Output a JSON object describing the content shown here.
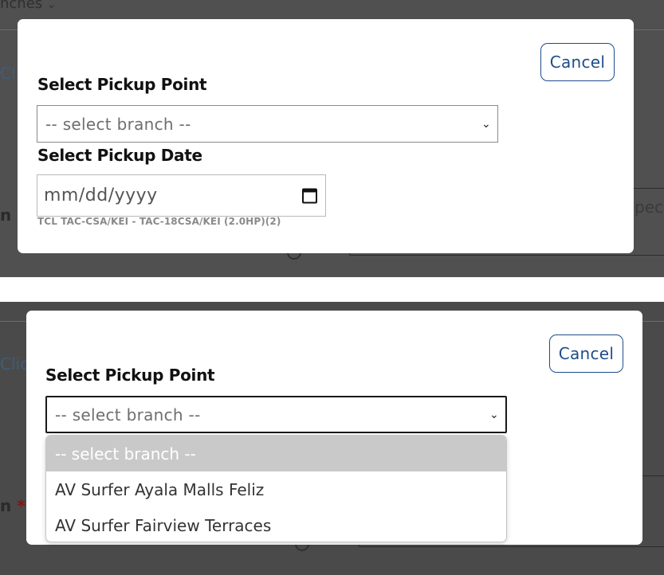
{
  "background": {
    "branches_label": "nches",
    "click_partial": "Clic",
    "location_partial": "n",
    "special_partial": "pecia"
  },
  "modal": {
    "cancel_label": "Cancel",
    "pickup_point_label": "Select Pickup Point",
    "pickup_date_label": "Select Pickup Date",
    "branch_placeholder": "-- select branch --",
    "date_placeholder": "mm/dd/yyyy",
    "product_caption": "TCL TAC-CSA/KEI - TAC-18CSA/KEI (2.0HP)(2)"
  },
  "dropdown": {
    "options": [
      "-- select branch --",
      "AV Surfer Ayala Malls Feliz",
      "AV Surfer Fairview Terraces"
    ],
    "highlighted_index": 0
  },
  "colors": {
    "accent": "#1f4c8a",
    "overlay": "#505050",
    "highlight": "#c9c9c9"
  }
}
